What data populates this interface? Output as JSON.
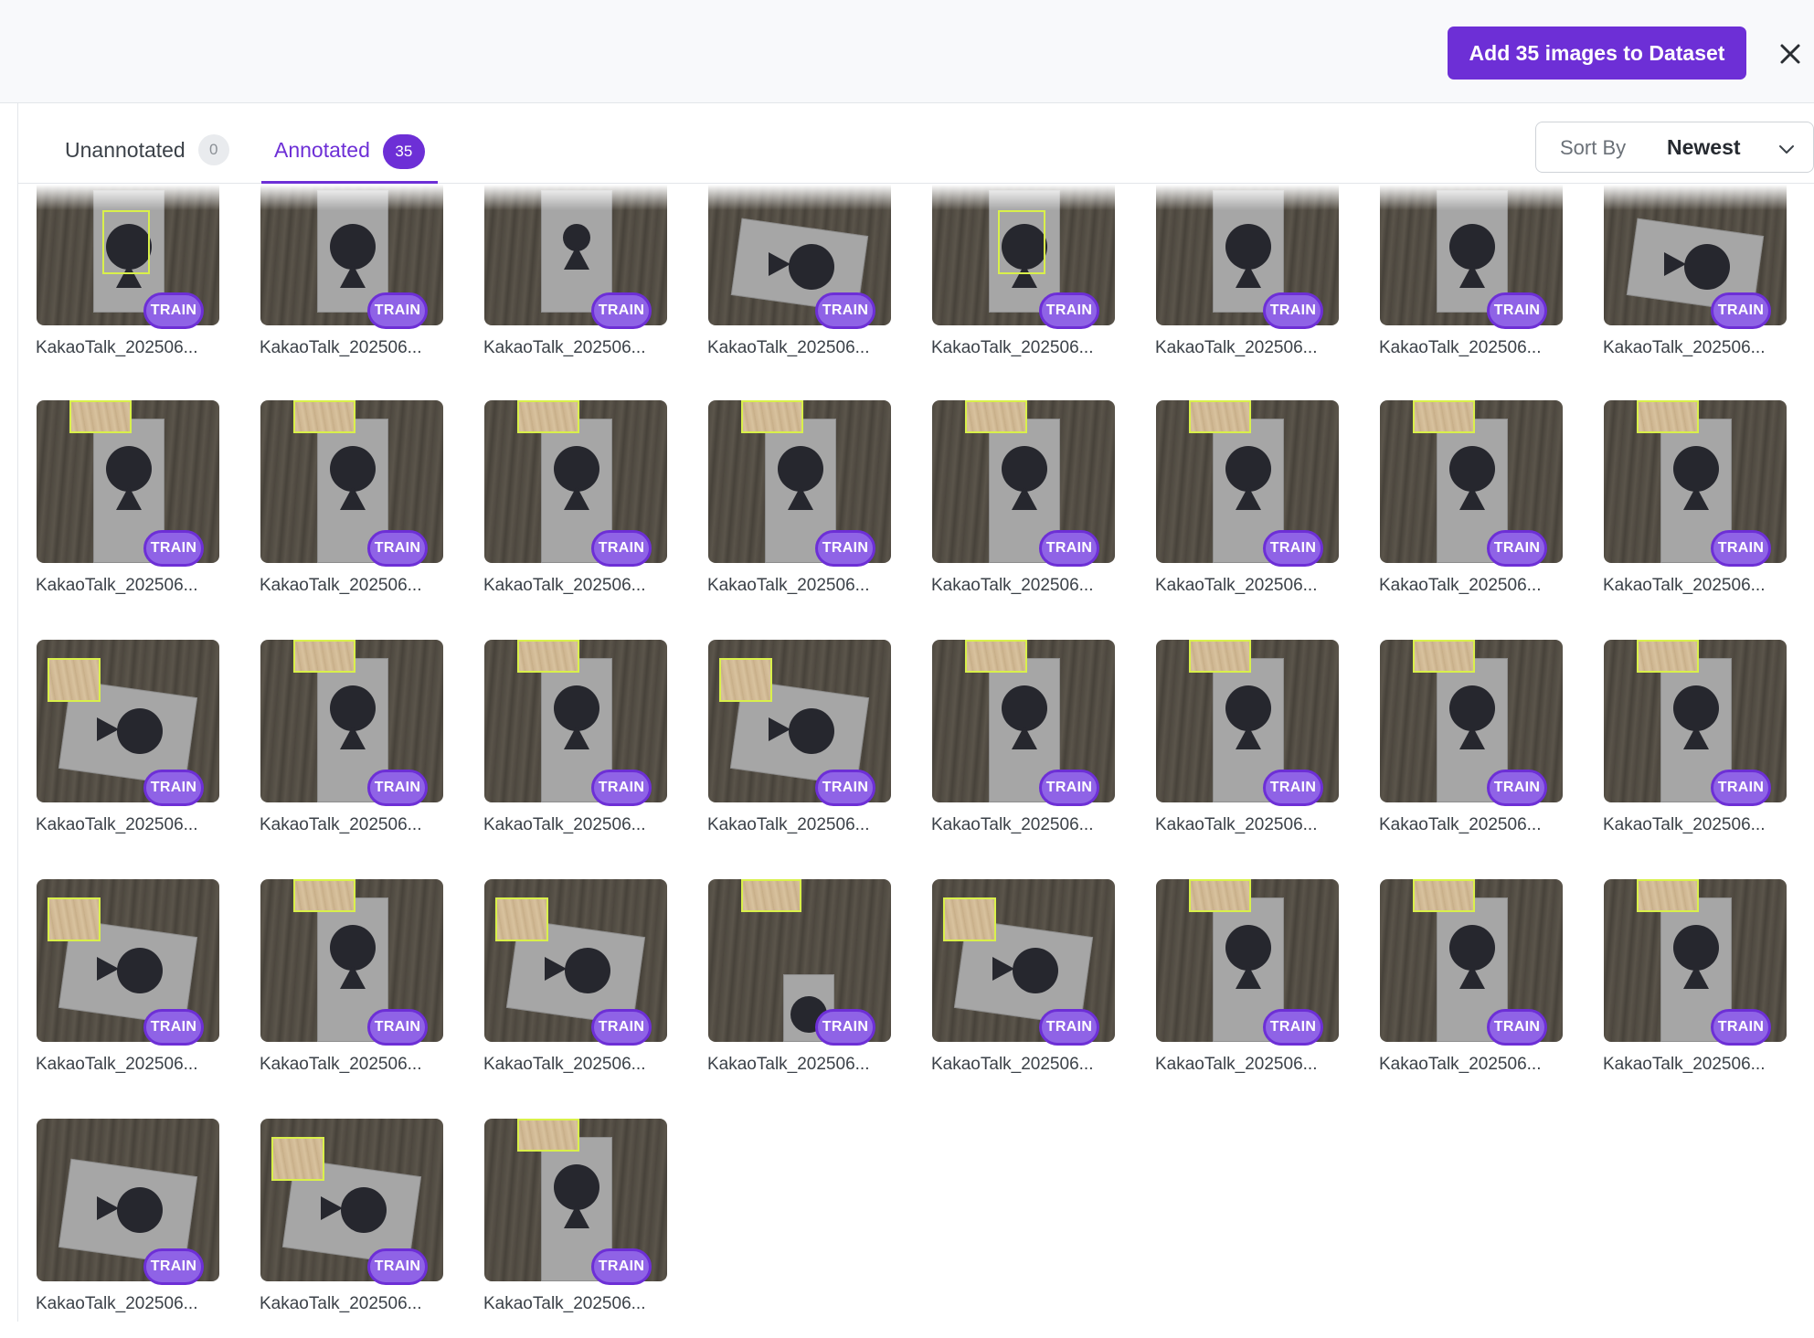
{
  "header": {
    "add_button_label": "Add 35 images to Dataset",
    "close_icon": "close-icon"
  },
  "tabs": [
    {
      "label": "Unannotated",
      "count": "0",
      "active": false
    },
    {
      "label": "Annotated",
      "count": "35",
      "active": true
    }
  ],
  "sort": {
    "label": "Sort By",
    "value": "Newest",
    "icon": "chevron-down-icon"
  },
  "colors": {
    "accent": "#6d2fd6",
    "badge": "#8f63e6",
    "bbox": "#d9f04a"
  },
  "images": [
    {
      "name": "KakaoTalk_202506...",
      "split": "TRAIN"
    },
    {
      "name": "KakaoTalk_202506...",
      "split": "TRAIN"
    },
    {
      "name": "KakaoTalk_202506...",
      "split": "TRAIN"
    },
    {
      "name": "KakaoTalk_202506...",
      "split": "TRAIN"
    },
    {
      "name": "KakaoTalk_202506...",
      "split": "TRAIN"
    },
    {
      "name": "KakaoTalk_202506...",
      "split": "TRAIN"
    },
    {
      "name": "KakaoTalk_202506...",
      "split": "TRAIN"
    },
    {
      "name": "KakaoTalk_202506...",
      "split": "TRAIN"
    },
    {
      "name": "KakaoTalk_202506...",
      "split": "TRAIN"
    },
    {
      "name": "KakaoTalk_202506...",
      "split": "TRAIN"
    },
    {
      "name": "KakaoTalk_202506...",
      "split": "TRAIN"
    },
    {
      "name": "KakaoTalk_202506...",
      "split": "TRAIN"
    },
    {
      "name": "KakaoTalk_202506...",
      "split": "TRAIN"
    },
    {
      "name": "KakaoTalk_202506...",
      "split": "TRAIN"
    },
    {
      "name": "KakaoTalk_202506...",
      "split": "TRAIN"
    },
    {
      "name": "KakaoTalk_202506...",
      "split": "TRAIN"
    },
    {
      "name": "KakaoTalk_202506...",
      "split": "TRAIN"
    },
    {
      "name": "KakaoTalk_202506...",
      "split": "TRAIN"
    },
    {
      "name": "KakaoTalk_202506...",
      "split": "TRAIN"
    },
    {
      "name": "KakaoTalk_202506...",
      "split": "TRAIN"
    },
    {
      "name": "KakaoTalk_202506...",
      "split": "TRAIN"
    },
    {
      "name": "KakaoTalk_202506...",
      "split": "TRAIN"
    },
    {
      "name": "KakaoTalk_202506...",
      "split": "TRAIN"
    },
    {
      "name": "KakaoTalk_202506...",
      "split": "TRAIN"
    },
    {
      "name": "KakaoTalk_202506...",
      "split": "TRAIN"
    },
    {
      "name": "KakaoTalk_202506...",
      "split": "TRAIN"
    },
    {
      "name": "KakaoTalk_202506...",
      "split": "TRAIN"
    },
    {
      "name": "KakaoTalk_202506...",
      "split": "TRAIN"
    },
    {
      "name": "KakaoTalk_202506...",
      "split": "TRAIN"
    },
    {
      "name": "KakaoTalk_202506...",
      "split": "TRAIN"
    },
    {
      "name": "KakaoTalk_202506...",
      "split": "TRAIN"
    },
    {
      "name": "KakaoTalk_202506...",
      "split": "TRAIN"
    },
    {
      "name": "KakaoTalk_202506...",
      "split": "TRAIN"
    },
    {
      "name": "KakaoTalk_202506...",
      "split": "TRAIN"
    },
    {
      "name": "KakaoTalk_202506...",
      "split": "TRAIN"
    }
  ]
}
